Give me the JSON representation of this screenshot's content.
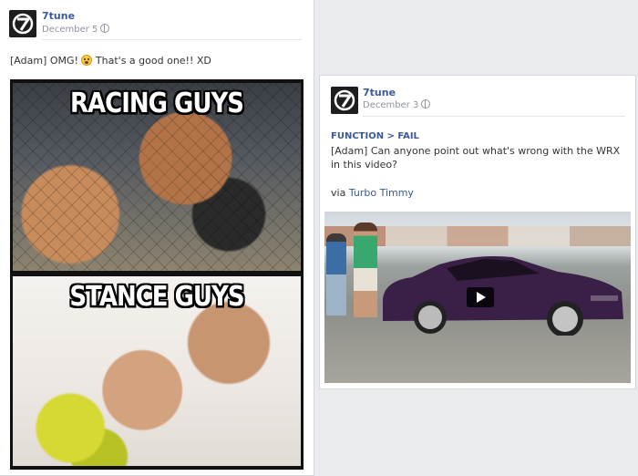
{
  "post1": {
    "author": "7tune",
    "date": "December 5",
    "caption": "[Adam] OMG! ",
    "caption_tail": " That's a good one!! XD",
    "emoji_icon": "surprised-face-icon",
    "meme_top_text": "RACING GUYS",
    "meme_bottom_text": "STANCE GUYS"
  },
  "post2": {
    "author": "7tune",
    "date": "December 3",
    "link_title": "FUNCTION > FAIL",
    "body": "[Adam] Can anyone point out what's wrong with the WRX in this video?",
    "via_prefix": "via ",
    "via_name": "Turbo Timmy",
    "video_icon": "play-icon"
  },
  "colors": {
    "link": "#3b5998",
    "background": "#e9ebee",
    "car_purple": "#3a1f47"
  }
}
